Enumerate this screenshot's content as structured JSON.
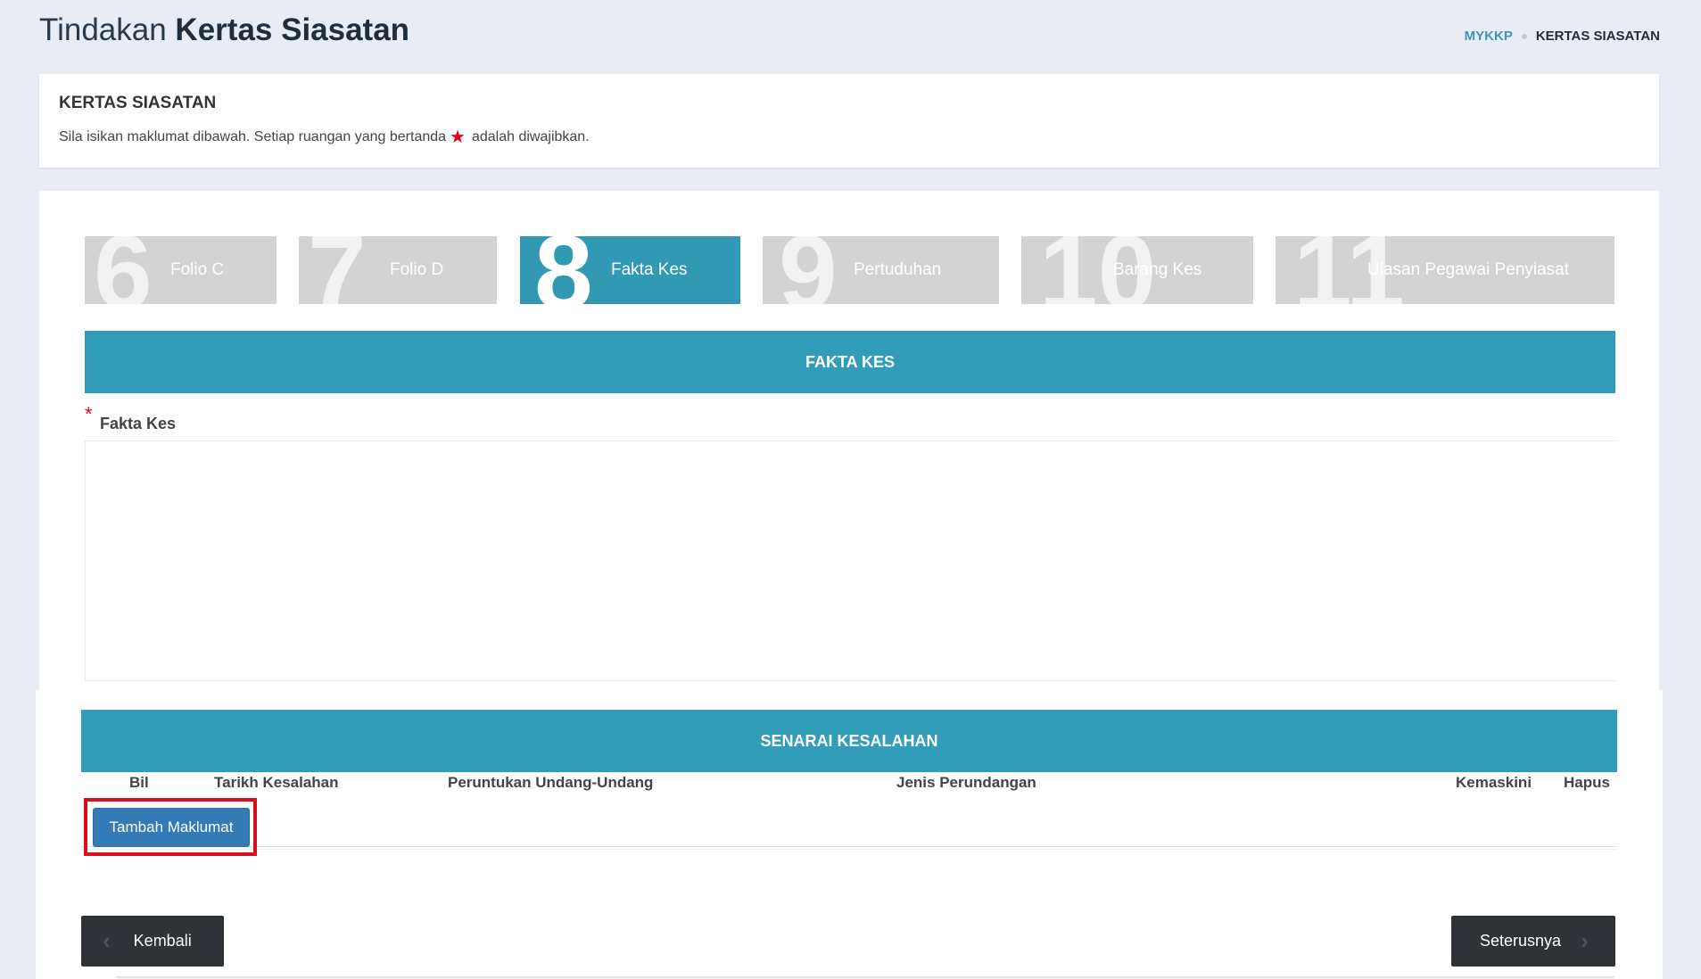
{
  "header": {
    "title_light": "Tindakan",
    "title_bold": "Kertas Siasatan",
    "breadcrumb": {
      "home": "MYKKP",
      "current": "KERTAS SIASATAN"
    }
  },
  "info": {
    "title": "KERTAS SIASATAN",
    "desc_before": "Sila isikan maklumat dibawah. Setiap ruangan yang bertanda",
    "desc_after": "adalah diwajibkan."
  },
  "steps": [
    {
      "number": "6",
      "label": "Folio C",
      "active": false
    },
    {
      "number": "7",
      "label": "Folio D",
      "active": false
    },
    {
      "number": "8",
      "label": "Fakta Kes",
      "active": true
    },
    {
      "number": "9",
      "label": "Pertuduhan",
      "active": false
    },
    {
      "number": "10",
      "label": "Barang Kes",
      "active": false
    },
    {
      "number": "11",
      "label": "Ulasan Pegawai Penyiasat",
      "active": false
    }
  ],
  "fakta_section": {
    "header": "FAKTA KES",
    "required_mark": "*",
    "field_label": "Fakta Kes",
    "value": ""
  },
  "kesalahan_section": {
    "header": "SENARAI KESALAHAN",
    "columns": [
      "Bil",
      "Tarikh Kesalahan",
      "Peruntukan Undang-Undang",
      "Jenis Perundangan",
      "Kemaskini",
      "Hapus"
    ],
    "add_button": "Tambah Maklumat"
  },
  "nav": {
    "back": "Kembali",
    "next": "Seterusnya"
  },
  "colors": {
    "accent": "#319db8",
    "primary_button": "#337ab7",
    "dark_button": "#2f3338",
    "required": "#e8001c",
    "highlight": "#d6111b"
  }
}
